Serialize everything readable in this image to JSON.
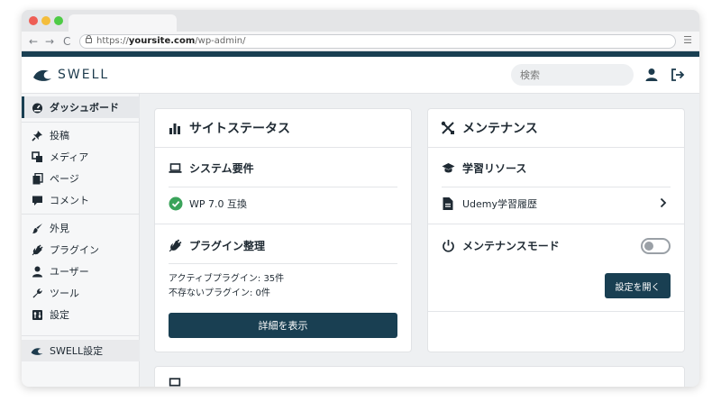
{
  "browser": {
    "url_scheme": "https://",
    "url_host": "yoursite.com",
    "url_path": "/wp-admin/",
    "back": "←",
    "forward": "→",
    "reload": "C",
    "menu": "☰"
  },
  "header": {
    "logo_text": "SWELL",
    "search_placeholder": "検索"
  },
  "sidebar": {
    "items": [
      {
        "label": "ダッシュボード",
        "icon": "gauge-icon"
      },
      {
        "label": "投稿",
        "icon": "pin-icon"
      },
      {
        "label": "メディア",
        "icon": "media-icon"
      },
      {
        "label": "ページ",
        "icon": "page-icon"
      },
      {
        "label": "コメント",
        "icon": "comment-icon"
      },
      {
        "label": "外見",
        "icon": "brush-icon"
      },
      {
        "label": "プラグイン",
        "icon": "plug-icon"
      },
      {
        "label": "ユーザー",
        "icon": "user-icon"
      },
      {
        "label": "ツール",
        "icon": "wrench-icon"
      },
      {
        "label": "設定",
        "icon": "settings-icon"
      },
      {
        "label": "SWELL設定",
        "icon": "swell-icon"
      }
    ]
  },
  "site_status": {
    "title": "サイトステータス",
    "requirements_title": "システム要件",
    "wp_compat": "WP 7.0 互換",
    "plugins_title": "プラグイン整理",
    "active_plugins": "アクティブプラグイン: 35件",
    "missing_plugins": "不存ないプラグイン: 0件",
    "details_button": "詳細を表示"
  },
  "maintenance": {
    "title": "メンテナンス",
    "learning_title": "学習リソース",
    "udemy_link": "Udemy学習履歴",
    "mode_label": "メンテナンスモード",
    "mode_enabled": false,
    "open_settings_button": "設定を開く"
  },
  "colors": {
    "brand": "#193f52",
    "success": "#3aa35a"
  }
}
